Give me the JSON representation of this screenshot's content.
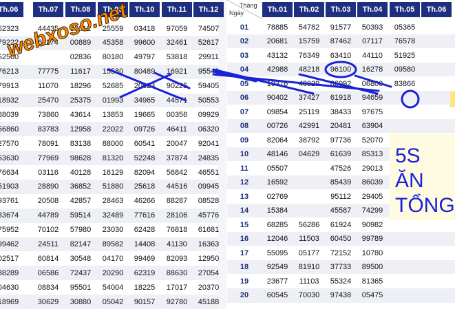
{
  "watermark": "webxoso.net",
  "corner": {
    "month_label": "Tháng",
    "day_label": "Ngày"
  },
  "left_headers": [
    "Th.06",
    "Th.07",
    "Th.08",
    "Th.09",
    "Th.10",
    "Th.11",
    "Th.12"
  ],
  "left_rows": [
    [
      "52323",
      "44435",
      "86012",
      "25559",
      "03418",
      "97059",
      "74507"
    ],
    [
      "79222",
      "61174",
      "00889",
      "45358",
      "99600",
      "32461",
      "52617"
    ],
    [
      "52500",
      "",
      "02836",
      "80180",
      "49797",
      "53818",
      "29911"
    ],
    [
      "76213",
      "77775",
      "11617",
      "15580",
      "80489",
      "16921",
      "95549"
    ],
    [
      "79913",
      "11070",
      "18296",
      "52685",
      "20623",
      "90225",
      "59405"
    ],
    [
      "18932",
      "25470",
      "25375",
      "01993",
      "34965",
      "44571",
      "50553"
    ],
    [
      "88039",
      "73860",
      "43614",
      "13853",
      "19665",
      "00356",
      "09929"
    ],
    [
      "56860",
      "83783",
      "12958",
      "22022",
      "09726",
      "46411",
      "06320"
    ],
    [
      "27570",
      "78091",
      "83138",
      "88000",
      "60541",
      "20047",
      "92041"
    ],
    [
      "53630",
      "77969",
      "98628",
      "81320",
      "52248",
      "37874",
      "24835"
    ],
    [
      "76634",
      "03116",
      "40128",
      "16129",
      "82094",
      "56842",
      "46551"
    ],
    [
      "51903",
      "28890",
      "36852",
      "51880",
      "25618",
      "44516",
      "09945"
    ],
    [
      "93761",
      "20508",
      "42857",
      "28463",
      "46266",
      "88287",
      "08528"
    ],
    [
      "33674",
      "44789",
      "59514",
      "32489",
      "77616",
      "28106",
      "45776"
    ],
    [
      "75952",
      "70102",
      "57980",
      "23030",
      "62428",
      "76818",
      "61681"
    ],
    [
      "99462",
      "24511",
      "82147",
      "89582",
      "14408",
      "41130",
      "16363"
    ],
    [
      "02517",
      "60814",
      "30548",
      "04170",
      "99469",
      "82093",
      "12950"
    ],
    [
      "38289",
      "06586",
      "72437",
      "20290",
      "62319",
      "88630",
      "27054"
    ],
    [
      "04630",
      "08834",
      "95501",
      "54004",
      "18225",
      "17017",
      "20370"
    ],
    [
      "18969",
      "30629",
      "30880",
      "05042",
      "90157",
      "92780",
      "45188"
    ]
  ],
  "right_headers": [
    "Th.01",
    "Th.02",
    "Th.03",
    "Th.04",
    "Th.05",
    "Th.06"
  ],
  "right_rows": [
    {
      "day": "01",
      "values": [
        "78885",
        "54782",
        "91577",
        "50393",
        "05365",
        ""
      ]
    },
    {
      "day": "02",
      "values": [
        "20681",
        "15759",
        "87462",
        "07117",
        "76578",
        ""
      ]
    },
    {
      "day": "03",
      "values": [
        "43132",
        "76349",
        "63410",
        "44110",
        "51925",
        ""
      ]
    },
    {
      "day": "04",
      "values": [
        "42988",
        "48218",
        "96100",
        "16278",
        "09580",
        ""
      ]
    },
    {
      "day": "05",
      "values": [
        "19376",
        "48029",
        "66092",
        "06800",
        "83866",
        ""
      ]
    },
    {
      "day": "06",
      "values": [
        "90402",
        "37427",
        "61918",
        "94659",
        "",
        ""
      ]
    },
    {
      "day": "07",
      "values": [
        "09854",
        "25119",
        "38433",
        "97675",
        "",
        ""
      ]
    },
    {
      "day": "08",
      "values": [
        "00726",
        "42991",
        "20481",
        "63904",
        "",
        ""
      ]
    },
    {
      "day": "09",
      "values": [
        "82064",
        "38792",
        "97736",
        "52070",
        "",
        ""
      ]
    },
    {
      "day": "10",
      "values": [
        "48146",
        "04629",
        "61639",
        "85313",
        "",
        ""
      ]
    },
    {
      "day": "11",
      "values": [
        "05507",
        "",
        "47526",
        "29013",
        "",
        ""
      ]
    },
    {
      "day": "12",
      "values": [
        "16592",
        "",
        "85439",
        "86039",
        "",
        ""
      ]
    },
    {
      "day": "13",
      "values": [
        "02769",
        "",
        "95112",
        "29405",
        "",
        ""
      ]
    },
    {
      "day": "14",
      "values": [
        "15384",
        "",
        "45587",
        "74299",
        "",
        ""
      ]
    },
    {
      "day": "15",
      "values": [
        "68285",
        "56286",
        "61924",
        "90982",
        "",
        ""
      ]
    },
    {
      "day": "16",
      "values": [
        "12046",
        "11503",
        "60450",
        "99789",
        "",
        ""
      ]
    },
    {
      "day": "17",
      "values": [
        "55095",
        "05177",
        "72152",
        "10780",
        "",
        ""
      ]
    },
    {
      "day": "18",
      "values": [
        "92549",
        "81910",
        "37733",
        "89500",
        "",
        ""
      ]
    },
    {
      "day": "19",
      "values": [
        "23677",
        "11103",
        "55324",
        "81365",
        "",
        ""
      ]
    },
    {
      "day": "20",
      "values": [
        "60545",
        "70030",
        "97438",
        "05475",
        "",
        ""
      ]
    }
  ],
  "annotation": {
    "line1": "5S",
    "line2": "ĂN",
    "line3": "TỔNG",
    "color": "#1a22d6"
  },
  "colors": {
    "header_bg": "#1d2f7e",
    "header_text": "#ffffff",
    "day_text": "#1d2f7e",
    "watermark": "#ff8a00"
  }
}
